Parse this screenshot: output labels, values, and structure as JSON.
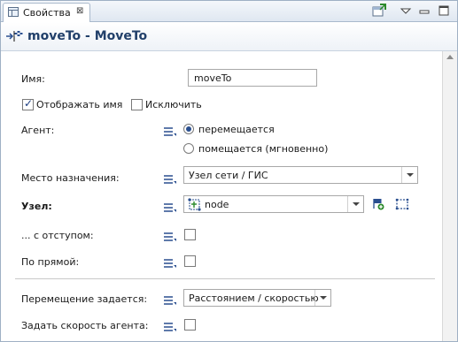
{
  "tab": {
    "icon": "properties-icon",
    "label": "Свойства",
    "close": "⊠"
  },
  "toolbar": {
    "icons": [
      "new-window-icon",
      "view-menu-icon",
      "minimize-icon",
      "maximize-icon"
    ]
  },
  "header": {
    "icon": "moveto-flag-icon",
    "title": "moveTo - MoveTo"
  },
  "form": {
    "name_label": "Имя:",
    "name_value": "moveTo",
    "show_name_label": "Отображать имя",
    "show_name_checked": true,
    "exclude_label": "Исключить",
    "exclude_checked": false,
    "agent_label": "Агент:",
    "agent_options": [
      "перемещается",
      "помещается (мгновенно)"
    ],
    "agent_selected": 0,
    "destination_label": "Место назначения:",
    "destination_value": "Узел сети / ГИС",
    "node_label": "Узел:",
    "node_value": "node",
    "offset_label": "... с отступом:",
    "straight_label": "По прямой:",
    "movement_label": "Перемещение задается:",
    "movement_value": "Расстоянием / скоростью",
    "speed_label": "Задать скорость агента:"
  }
}
